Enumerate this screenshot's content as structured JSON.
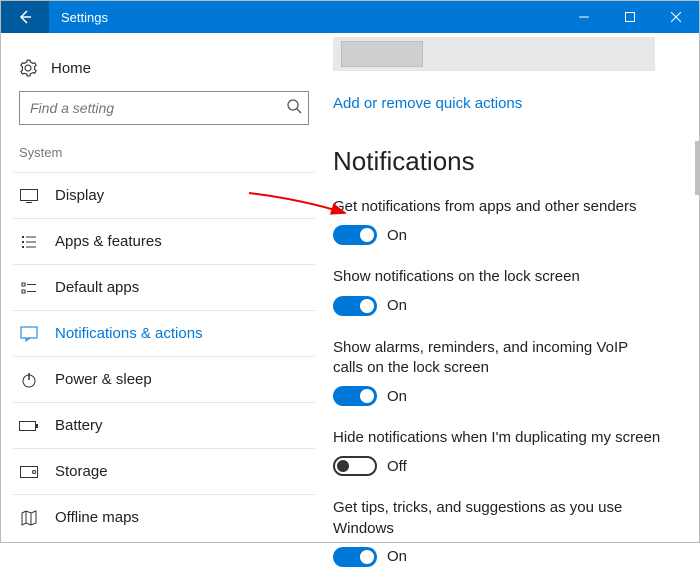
{
  "window": {
    "title": "Settings"
  },
  "sidebar": {
    "home": "Home",
    "search_placeholder": "Find a setting",
    "group": "System",
    "items": [
      {
        "label": "Display"
      },
      {
        "label": "Apps & features"
      },
      {
        "label": "Default apps"
      },
      {
        "label": "Notifications & actions"
      },
      {
        "label": "Power & sleep"
      },
      {
        "label": "Battery"
      },
      {
        "label": "Storage"
      },
      {
        "label": "Offline maps"
      }
    ]
  },
  "main": {
    "quick_actions_link": "Add or remove quick actions",
    "section_title": "Notifications",
    "settings": [
      {
        "label": "Get notifications from apps and other senders",
        "state": "On"
      },
      {
        "label": "Show notifications on the lock screen",
        "state": "On"
      },
      {
        "label": "Show alarms, reminders, and incoming VoIP calls on the lock screen",
        "state": "On"
      },
      {
        "label": "Hide notifications when I'm duplicating my screen",
        "state": "Off"
      },
      {
        "label": "Get tips, tricks, and suggestions as you use Windows",
        "state": "On"
      }
    ]
  }
}
